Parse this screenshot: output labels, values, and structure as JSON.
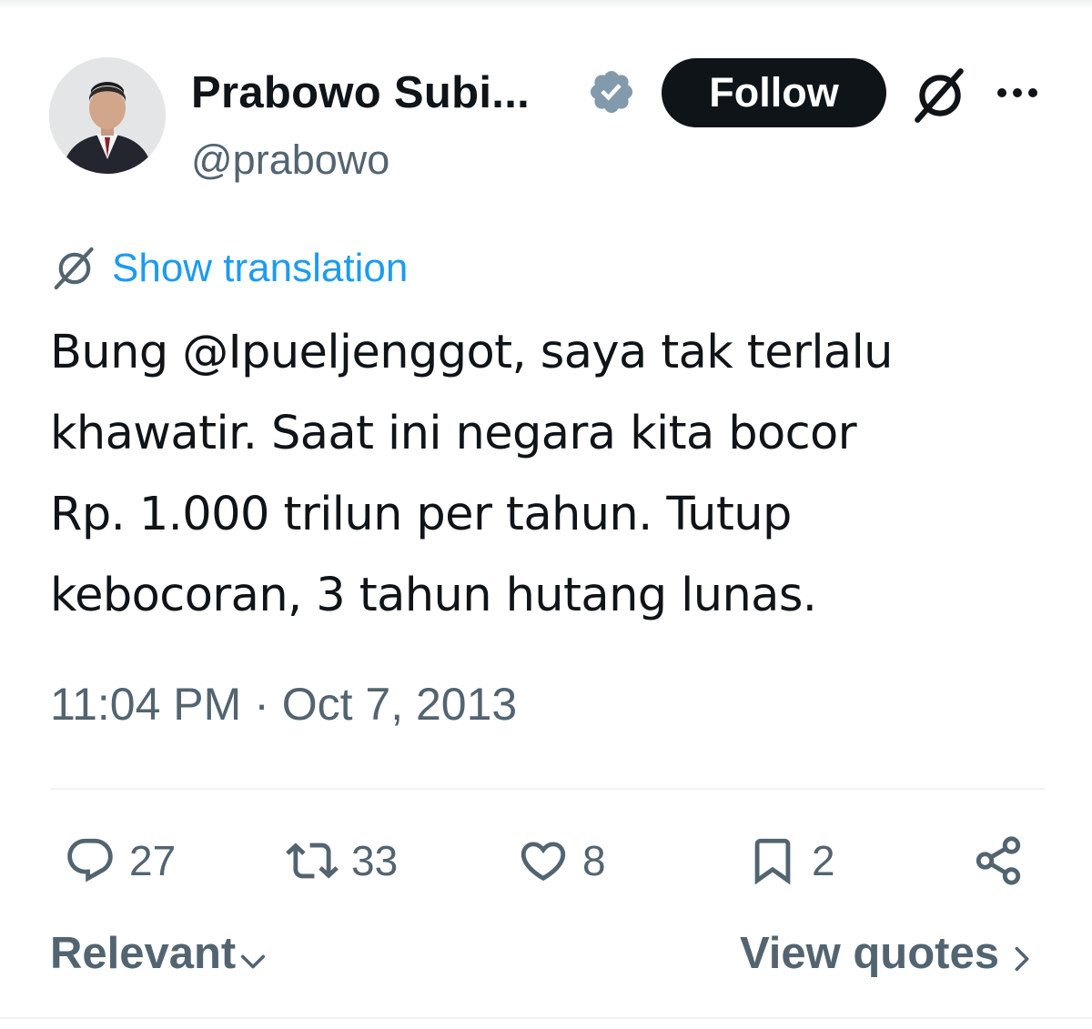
{
  "author": {
    "display_name": "Prabowo Subi...",
    "handle": "@prabowo",
    "verified": true,
    "verified_color": "#829aab",
    "avatar_icon": "avatar"
  },
  "header_actions": {
    "follow_label": "Follow",
    "grok_icon": "grok-icon",
    "more_icon": "more-icon"
  },
  "translation": {
    "label": "Show translation",
    "icon": "grok-icon",
    "color": "#1d9bf0"
  },
  "tweet": {
    "text": "Bung @Ipueljenggot, saya tak terlalu\nkhawatir. Saat ini negara kita bocor\nRp. 1.000 trilun per tahun. Tutup\nkebocoran, 3 tahun hutang lunas.",
    "timestamp": "11:04 PM · Oct 7, 2013"
  },
  "actions": {
    "replies": "27",
    "reposts": "33",
    "likes": "8",
    "bookmarks": "2",
    "share_icon": "share-icon"
  },
  "footer": {
    "sort_label": "Relevant",
    "view_quotes_label": "View quotes"
  },
  "colors": {
    "text_primary": "#0f1419",
    "text_secondary": "#536471",
    "follow_bg": "#0f1419",
    "divider": "#eff3f4"
  }
}
